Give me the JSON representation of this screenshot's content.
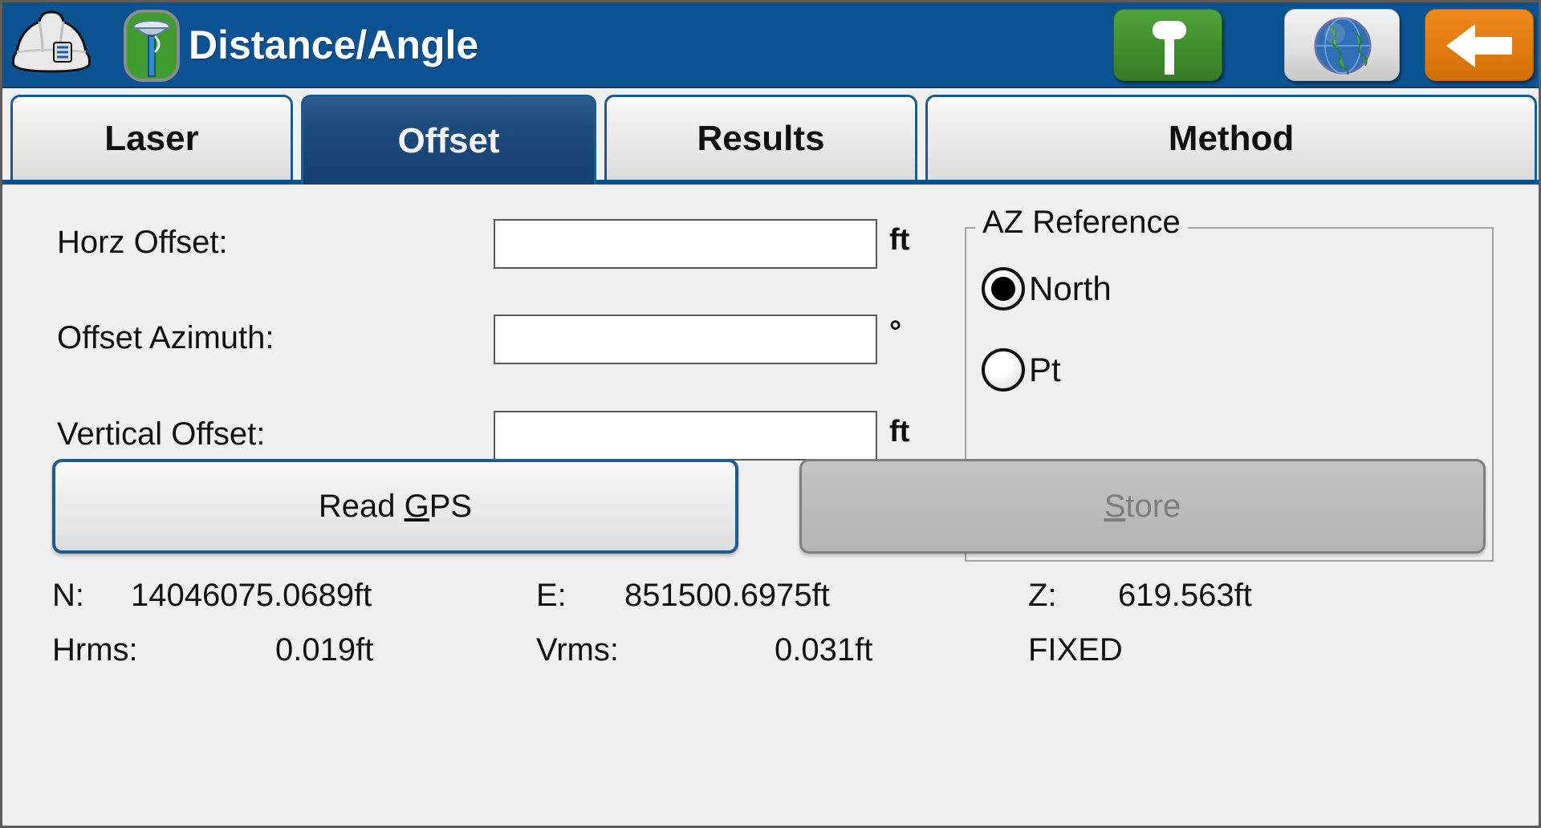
{
  "window": {
    "title": "Distance/Angle",
    "accent_blue": "#0a5291",
    "panel_bg": "#f0f0f0"
  },
  "titlebar": {
    "helmet_icon": "hard-hat-icon",
    "app_icon": "gps-rover-icon",
    "buttons": [
      {
        "name": "gps-rover-button",
        "icon": "antenna-pole-icon",
        "color": "#3f8d2d"
      },
      {
        "name": "map-globe-button",
        "icon": "globe-icon",
        "color": "#dedede"
      },
      {
        "name": "back-button",
        "icon": "arrow-left-icon",
        "color": "#e07c10"
      }
    ]
  },
  "tabs": [
    {
      "label": "Laser",
      "active": false
    },
    {
      "label": "Offset",
      "active": true
    },
    {
      "label": "Results",
      "active": false
    },
    {
      "label": "Method",
      "active": false
    }
  ],
  "form": {
    "fields": [
      {
        "label": "Horz Offset:",
        "value": "",
        "placeholder": "",
        "unit": "ft"
      },
      {
        "label": "Offset Azimuth:",
        "value": "",
        "placeholder": "",
        "unit": "°"
      },
      {
        "label": "Vertical Offset:",
        "value": "",
        "placeholder": "",
        "unit": "ft"
      }
    ]
  },
  "az_reference": {
    "title": "AZ Reference",
    "options": [
      {
        "label": "North",
        "selected": true
      },
      {
        "label": "Pt",
        "selected": false
      }
    ]
  },
  "buttons": {
    "read_gps": {
      "label_before": "Read ",
      "accel": "G",
      "label_after": "PS",
      "enabled": true
    },
    "store": {
      "accel": "S",
      "label_after": "tore",
      "enabled": false
    }
  },
  "status": {
    "n_label": "N:",
    "n_value": "14046075.0689ft",
    "e_label": "E:",
    "e_value": "851500.6975ft",
    "z_label": "Z:",
    "z_value": "619.563ft",
    "hrms_label": "Hrms:",
    "hrms_value": "0.019ft",
    "vrms_label": "Vrms:",
    "vrms_value": "0.031ft",
    "fix_status": "FIXED"
  }
}
